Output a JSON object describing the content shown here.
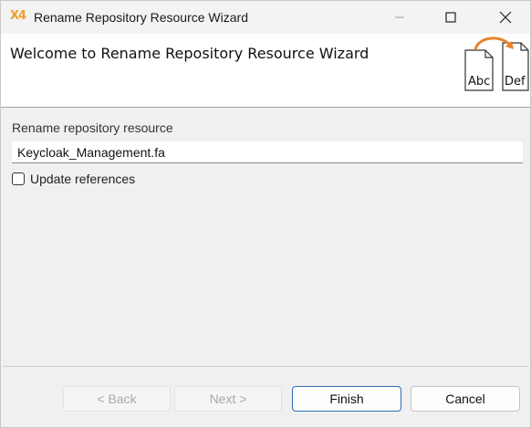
{
  "window": {
    "app_logo": "X4",
    "title": "Rename Repository Resource Wizard"
  },
  "header": {
    "title": "Welcome to Rename Repository Resource Wizard",
    "icon_from": "Abc",
    "icon_to": "Def"
  },
  "form": {
    "label": "Rename repository resource",
    "value": "Keycloak_Management.fa",
    "update_references_label": "Update references",
    "update_references_checked": false
  },
  "buttons": {
    "back": "< Back",
    "next": "Next >",
    "finish": "Finish",
    "cancel": "Cancel"
  },
  "colors": {
    "accent": "#2c6fb5",
    "arrow": "#e8842c",
    "logo": "#f0a030"
  }
}
